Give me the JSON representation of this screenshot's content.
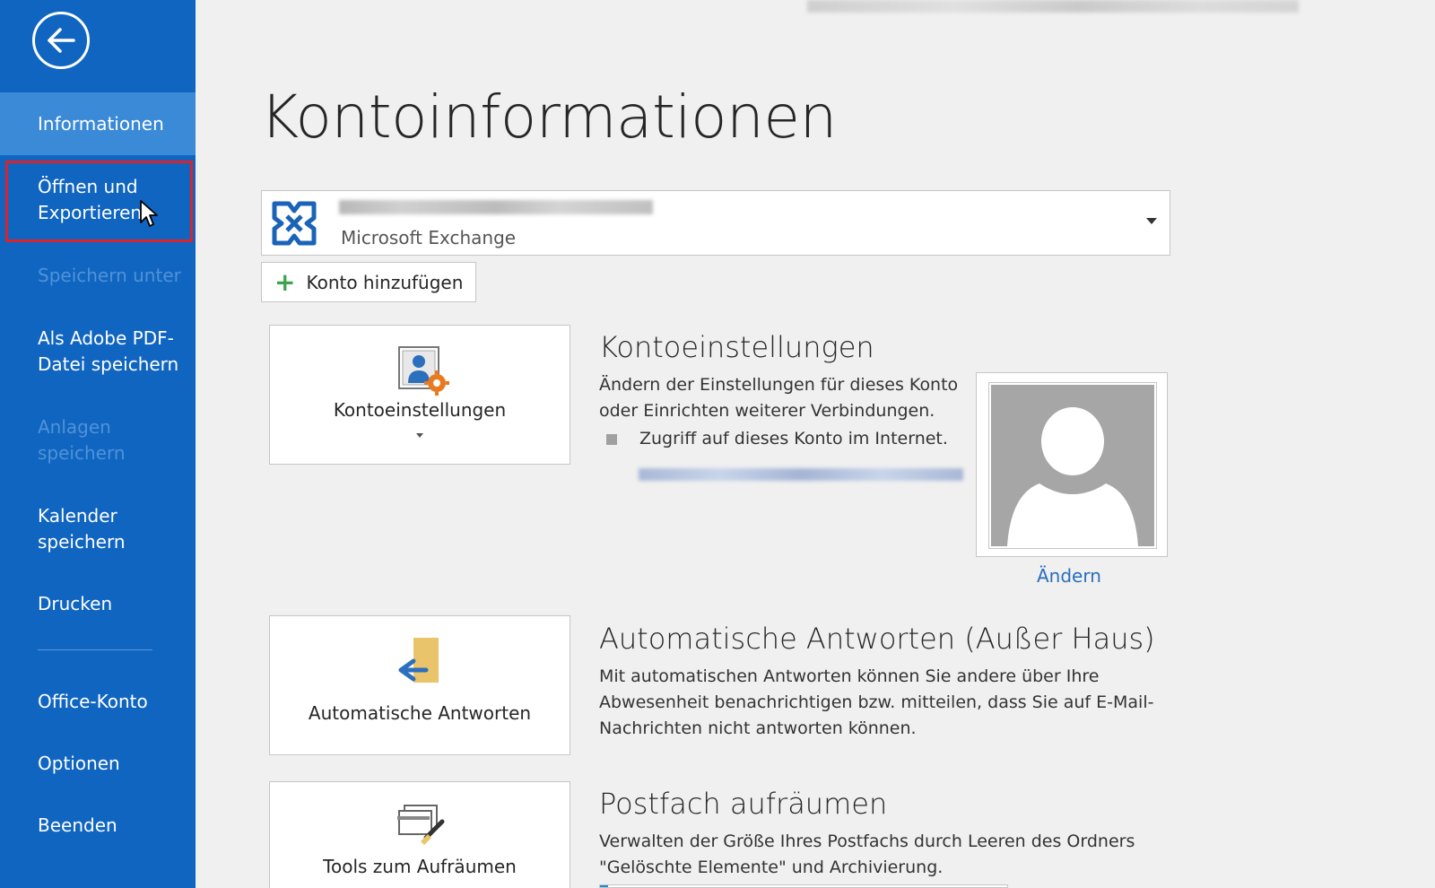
{
  "sidebar": {
    "items": [
      {
        "label": "Informationen"
      },
      {
        "label": "Öffnen und Exportieren"
      },
      {
        "label": "Speichern unter"
      },
      {
        "label": "Als Adobe PDF-Datei speichern"
      },
      {
        "label": "Anlagen speichern"
      },
      {
        "label": "Kalender speichern"
      },
      {
        "label": "Drucken"
      },
      {
        "label": "Office-Konto"
      },
      {
        "label": "Optionen"
      },
      {
        "label": "Beenden"
      }
    ]
  },
  "main": {
    "title": "Kontoinformationen",
    "account": {
      "type": "Microsoft Exchange"
    },
    "add_account_label": "Konto hinzufügen",
    "sections": [
      {
        "tile_label": "Kontoeinstellungen",
        "title": "Kontoeinstellungen",
        "description": "Ändern der Einstellungen für dieses Konto oder Einrichten weiterer Verbindungen.",
        "bullet": "Zugriff auf dieses Konto im Internet."
      },
      {
        "tile_label": "Automatische Antworten",
        "title": "Automatische Antworten (Außer Haus)",
        "description": "Mit automatischen Antworten können Sie andere über Ihre Abwesenheit benachrichtigen bzw. mitteilen, dass Sie auf E-Mail-Nachrichten nicht antworten können."
      },
      {
        "tile_label": "Tools zum Aufräumen",
        "title": "Postfach aufräumen",
        "description": "Verwalten der Größe Ihres Postfachs durch Leeren des Ordners \"Gelöschte Elemente\" und Archivierung."
      }
    ],
    "profile": {
      "change_label": "Ändern"
    }
  },
  "colors": {
    "sidebar_bg": "#1065c1",
    "sidebar_active": "#3a8ad8",
    "highlight": "#d9232c",
    "link": "#2a6ebb"
  }
}
